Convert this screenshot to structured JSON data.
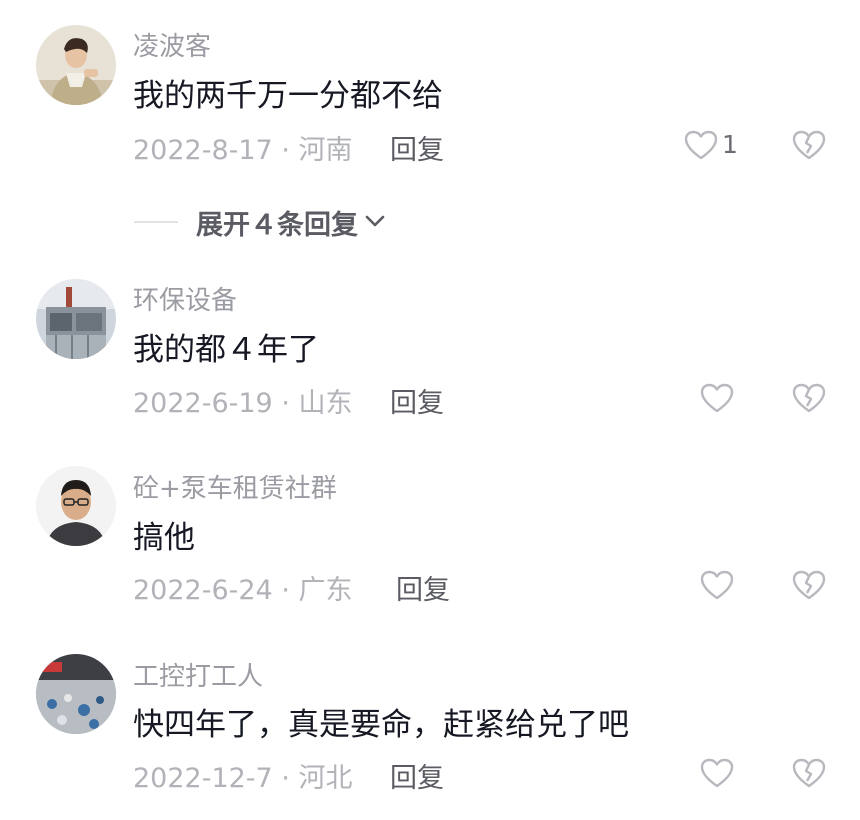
{
  "comments": [
    {
      "username": "凌波客",
      "text": "我的两千万一分都不给",
      "date_location": "2022-8-17 · 河南",
      "reply_label": "回复",
      "like_count": "1",
      "avatar_icon": "user-photo-avatar"
    },
    {
      "username": "环保设备",
      "text": "我的都４年了",
      "date_location": "2022-6-19 · 山东",
      "reply_label": "回复",
      "avatar_icon": "factory-photo-avatar"
    },
    {
      "username": "砼+泵车租赁社群",
      "text": "搞他",
      "date_location": "2022-6-24 · 广东",
      "reply_label": "回复",
      "avatar_icon": "user-photo-avatar"
    },
    {
      "username": "工控打工人",
      "text": "快四年了，真是要命，赶紧给兑了吧",
      "date_location": "2022-12-7 · 河北",
      "reply_label": "回复",
      "avatar_icon": "crowd-photo-avatar"
    }
  ],
  "expand_replies": {
    "label": "展开４条回复"
  },
  "icons": {
    "like": "heart-outline-icon",
    "dislike": "broken-heart-icon",
    "expand": "chevron-down-icon"
  },
  "colors": {
    "text": "#161823",
    "secondary": "#9b9ca3",
    "meta": "#b2b3b8",
    "icon": "#b8b9be"
  }
}
